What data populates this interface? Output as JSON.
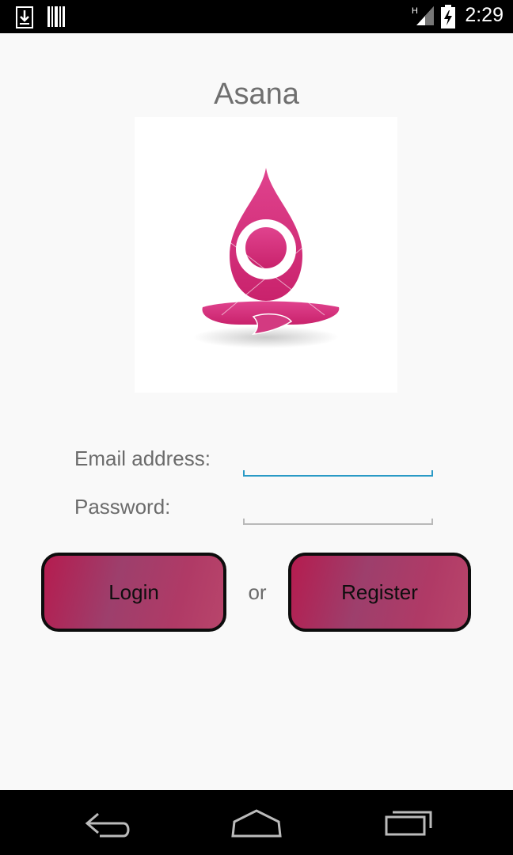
{
  "status_bar": {
    "time": "2:29",
    "icons": [
      "download-icon",
      "barcode-icon",
      "signal-icon",
      "battery-charging-icon"
    ],
    "network_type": "H"
  },
  "app": {
    "title": "Asana",
    "logo": "lotus-meditation-logo",
    "accent_color": "#d6347f"
  },
  "form": {
    "email_label": "Email address:",
    "email_value": "",
    "password_label": "Password:",
    "password_value": ""
  },
  "actions": {
    "login_label": "Login",
    "separator": "or",
    "register_label": "Register"
  },
  "nav_bar": {
    "buttons": [
      "back-icon",
      "home-icon",
      "recent-apps-icon"
    ]
  }
}
